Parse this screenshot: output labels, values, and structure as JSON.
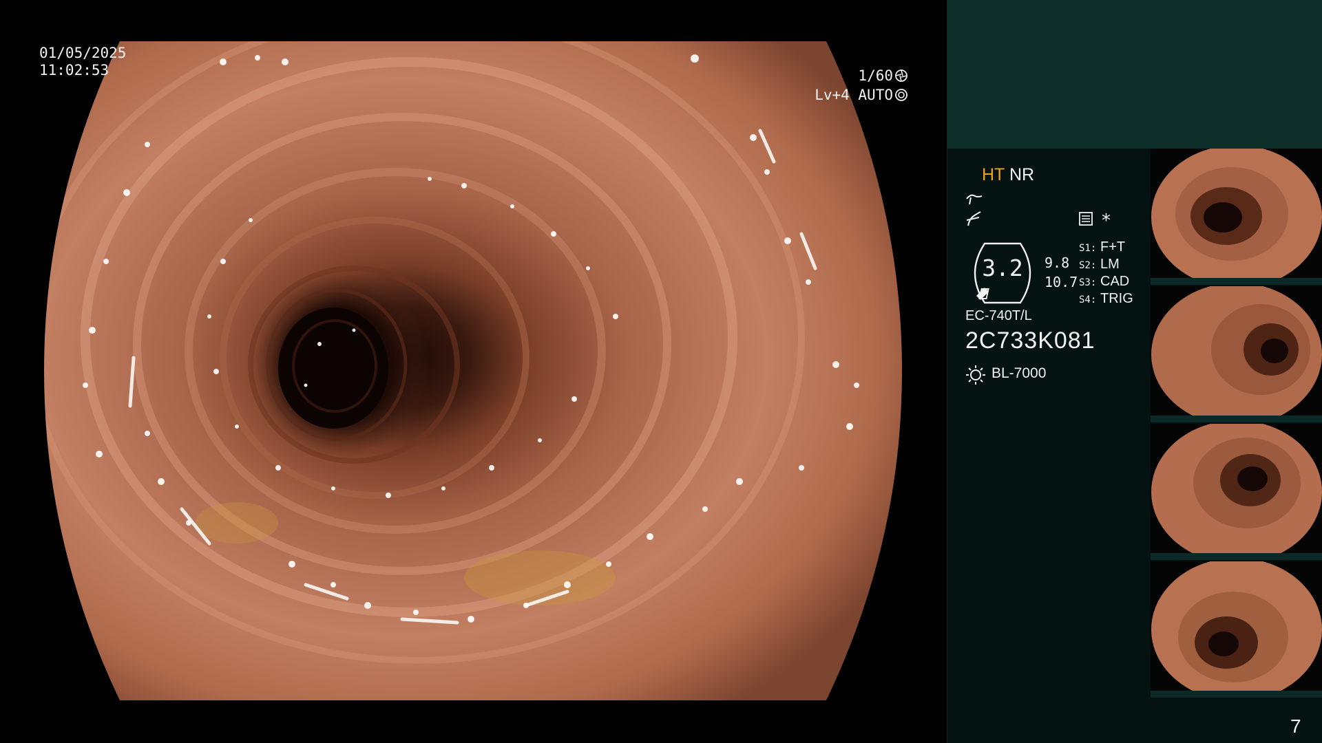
{
  "osd": {
    "date": "01/05/2025",
    "time": "11:02:53",
    "shutter": "1/60",
    "shutter_icon": "shutter-icon",
    "iris": "Lv+4 AUTO",
    "iris_icon": "iris-icon"
  },
  "panel": {
    "ht_label": "HT",
    "nr_label": "NR",
    "contrast_icon": "contrast-curve-icon",
    "structure_icon": "structure-enhance-icon",
    "capture_icon": "capture-settings-icon",
    "asterisk": "*",
    "dial": {
      "value": "3.2",
      "value_top": "9.8",
      "value_bottom": "10.7"
    },
    "switches": [
      {
        "key": "S1:",
        "value": "F+T"
      },
      {
        "key": "S2:",
        "value": "LM"
      },
      {
        "key": "S3:",
        "value": "CAD"
      },
      {
        "key": "S4:",
        "value": "TRIG"
      }
    ],
    "scope_model": "EC-740T/L",
    "scope_serial": "2C733K081",
    "light_icon": "light-source-icon",
    "light_source": "BL-7000"
  },
  "thumbnails": [
    {
      "label": "capture-1"
    },
    {
      "label": "capture-2"
    },
    {
      "label": "capture-3"
    },
    {
      "label": "capture-4"
    }
  ],
  "page_number": "7",
  "colors": {
    "panel_bg": "#041312",
    "panel_header": "#0f2f2b",
    "ht_accent": "#f0a020",
    "mucosa": "#b87252"
  }
}
